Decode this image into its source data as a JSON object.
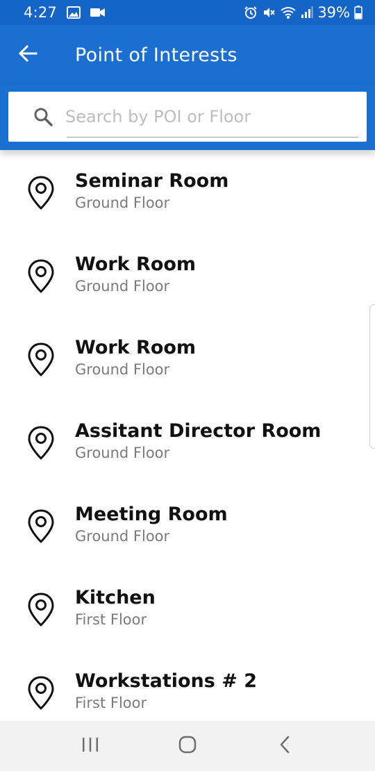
{
  "status_bar": {
    "time": "4:27",
    "battery": "39%",
    "left_icons": [
      "image-icon",
      "video-camera-icon"
    ],
    "right_icons": [
      "alarm-icon",
      "mute-icon",
      "wifi-icon",
      "signal-icon",
      "battery-icon"
    ]
  },
  "app_bar": {
    "title": "Point of Interests",
    "back_icon": "arrow-back-icon"
  },
  "search": {
    "placeholder": "Search by POI or Floor",
    "value": "",
    "icon": "search-icon"
  },
  "poi_items": [
    {
      "name": "Seminar Room",
      "floor": "Ground Floor",
      "icon": "location-pin-icon"
    },
    {
      "name": "Work Room",
      "floor": "Ground Floor",
      "icon": "location-pin-icon"
    },
    {
      "name": "Work Room",
      "floor": "Ground Floor",
      "icon": "location-pin-icon"
    },
    {
      "name": "Assitant Director Room",
      "floor": "Ground Floor",
      "icon": "location-pin-icon"
    },
    {
      "name": "Meeting Room",
      "floor": "Ground Floor",
      "icon": "location-pin-icon"
    },
    {
      "name": "Kitchen",
      "floor": "First Floor",
      "icon": "location-pin-icon"
    },
    {
      "name": "Workstations # 2",
      "floor": "First Floor",
      "icon": "location-pin-icon"
    }
  ],
  "nav_bar": {
    "buttons": [
      "recent-apps-icon",
      "home-icon",
      "back-icon"
    ]
  },
  "colors": {
    "primary": "#1b6fd0",
    "status_bar": "#1565c8",
    "title_text": "#ffffff",
    "item_title": "#111111",
    "item_subtitle": "#7a7a7a",
    "nav_bar": "#f2f2f2"
  }
}
